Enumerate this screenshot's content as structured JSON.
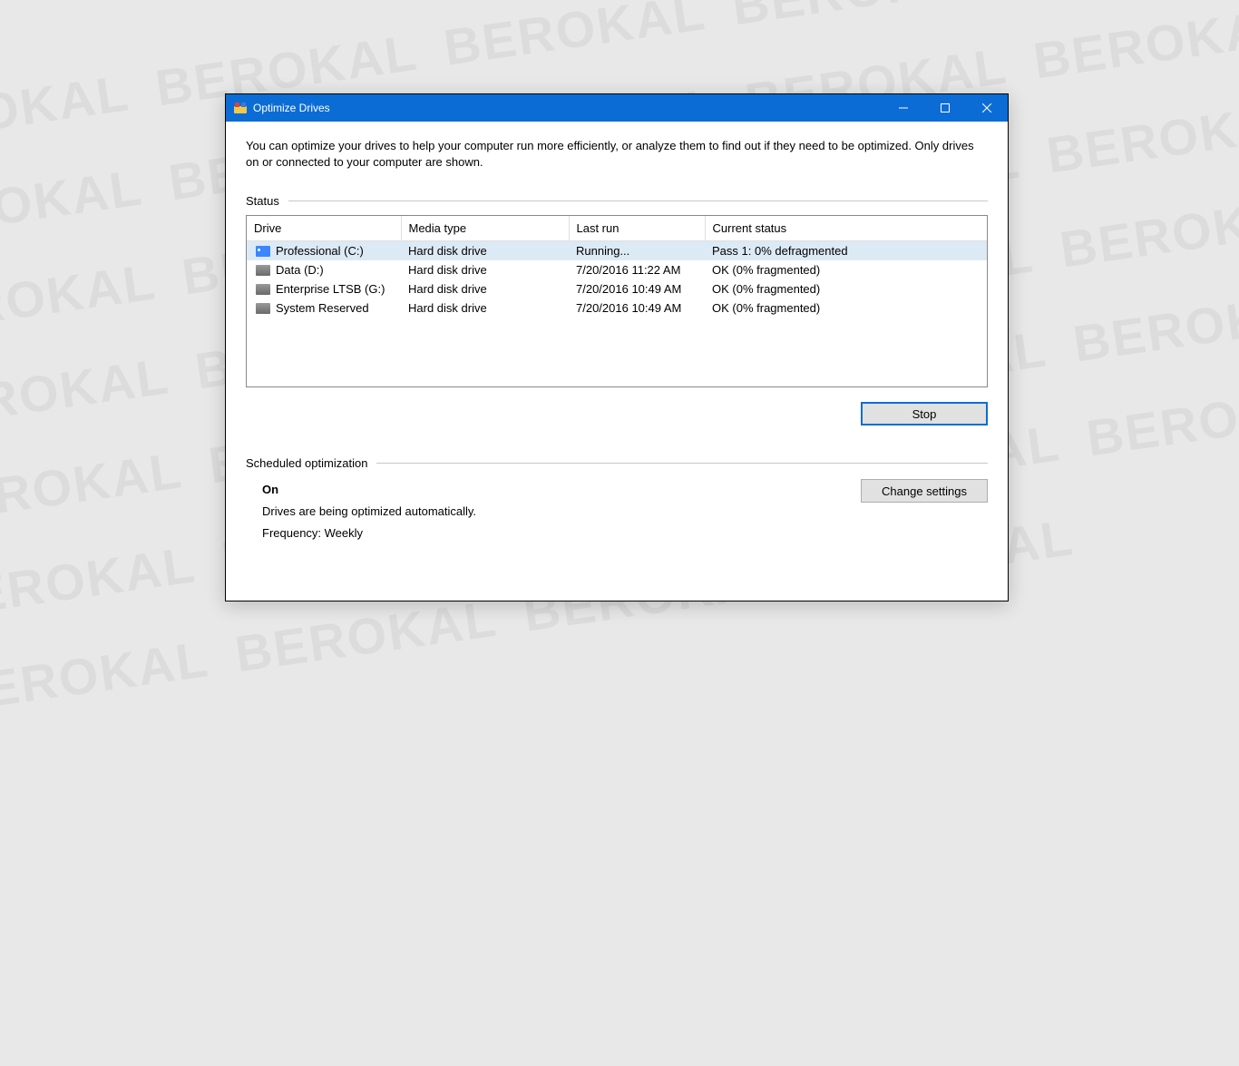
{
  "window": {
    "title": "Optimize Drives",
    "intro": "You can optimize your drives to help your computer run more efficiently, or analyze them to find out if they need to be optimized. Only drives on or connected to your computer are shown."
  },
  "status": {
    "label": "Status",
    "columns": {
      "drive": "Drive",
      "media": "Media type",
      "last_run": "Last run",
      "status": "Current status"
    },
    "rows": [
      {
        "name": "Professional (C:)",
        "media": "Hard disk drive",
        "last_run": "Running...",
        "status": "Pass 1: 0% defragmented",
        "primary": true,
        "selected": true
      },
      {
        "name": "Data (D:)",
        "media": "Hard disk drive",
        "last_run": "7/20/2016 11:22 AM",
        "status": "OK (0% fragmented)",
        "primary": false,
        "selected": false
      },
      {
        "name": "Enterprise LTSB (G:)",
        "media": "Hard disk drive",
        "last_run": "7/20/2016 10:49 AM",
        "status": "OK (0% fragmented)",
        "primary": false,
        "selected": false
      },
      {
        "name": "System Reserved",
        "media": "Hard disk drive",
        "last_run": "7/20/2016 10:49 AM",
        "status": "OK (0% fragmented)",
        "primary": false,
        "selected": false
      }
    ]
  },
  "buttons": {
    "stop": "Stop",
    "change_settings": "Change settings"
  },
  "scheduled": {
    "label": "Scheduled optimization",
    "state": "On",
    "desc": "Drives are being optimized automatically.",
    "freq": "Frequency: Weekly"
  },
  "watermark": "BEROKAL"
}
